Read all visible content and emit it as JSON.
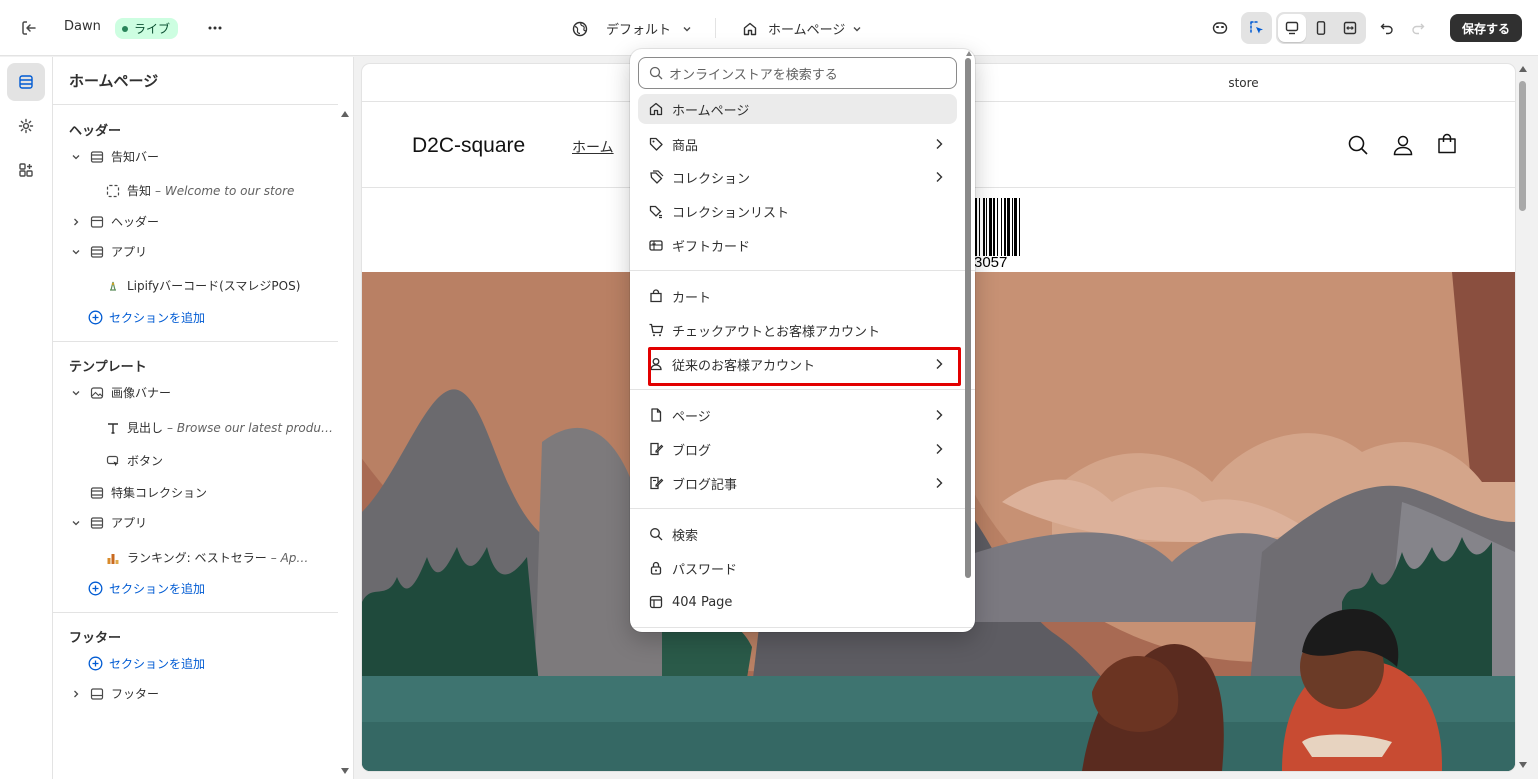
{
  "topbar": {
    "theme_name": "Dawn",
    "live_badge": "ライブ",
    "more_label": "•••",
    "language_selector": "デフォルト",
    "page_selector": "ホームページ",
    "save_label": "保存する"
  },
  "rail": {
    "items": [
      "sections-icon",
      "settings-gear-icon",
      "apps-icon"
    ]
  },
  "sidebar": {
    "title": "ホームページ",
    "header_group": "ヘッダー",
    "header_items": {
      "announcement_bar": "告知バー",
      "announcement": "告知",
      "announcement_sub": "– Welcome to our store",
      "header": "ヘッダー",
      "app": "アプリ",
      "barcode_block": "Lipifyバーコード(スマレジPOS)",
      "add_section": "セクションを追加"
    },
    "template_group": "テンプレート",
    "template_items": {
      "image_banner": "画像バナー",
      "heading": "見出し",
      "heading_sub": "– Browse our latest produ…",
      "button": "ボタン",
      "featured_collection": "特集コレクション",
      "app": "アプリ",
      "ranking": "ランキング: ベストセラー",
      "ranking_sub": "– Ap…",
      "add_section": "セクションを追加"
    },
    "footer_group": "フッター",
    "footer_items": {
      "add_section": "セクションを追加",
      "footer": "フッター"
    }
  },
  "preview": {
    "announcement_text": "store",
    "brand": "D2C-square",
    "nav_home": "ホーム",
    "barcode_number": "3057"
  },
  "dropdown": {
    "search_placeholder": "オンラインストアを検索する",
    "items": [
      {
        "label": "ホームページ",
        "icon": "home-icon",
        "arrow": false
      },
      {
        "label": "商品",
        "icon": "tag-icon",
        "arrow": true
      },
      {
        "label": "コレクション",
        "icon": "collection-tag-icon",
        "arrow": true
      },
      {
        "label": "コレクションリスト",
        "icon": "collection-list-icon",
        "arrow": false
      },
      {
        "label": "ギフトカード",
        "icon": "gift-card-icon",
        "arrow": false
      },
      {
        "label": "カート",
        "icon": "bag-icon",
        "arrow": false
      },
      {
        "label": "チェックアウトとお客様アカウント",
        "icon": "cart-icon",
        "arrow": false
      },
      {
        "label": "従来のお客様アカウント",
        "icon": "person-icon",
        "arrow": true
      },
      {
        "label": "ページ",
        "icon": "page-icon",
        "arrow": true
      },
      {
        "label": "ブログ",
        "icon": "blog-icon",
        "arrow": true
      },
      {
        "label": "ブログ記事",
        "icon": "blog-post-icon",
        "arrow": true
      },
      {
        "label": "検索",
        "icon": "search-icon",
        "arrow": false
      },
      {
        "label": "パスワード",
        "icon": "lock-icon",
        "arrow": false
      },
      {
        "label": "404 Page",
        "icon": "page-404-icon",
        "arrow": false
      }
    ]
  },
  "colors": {
    "accent": "#005bd3",
    "highlight": "#e20000",
    "live_badge_bg": "#cdfee1",
    "save_button_bg": "#303030"
  }
}
